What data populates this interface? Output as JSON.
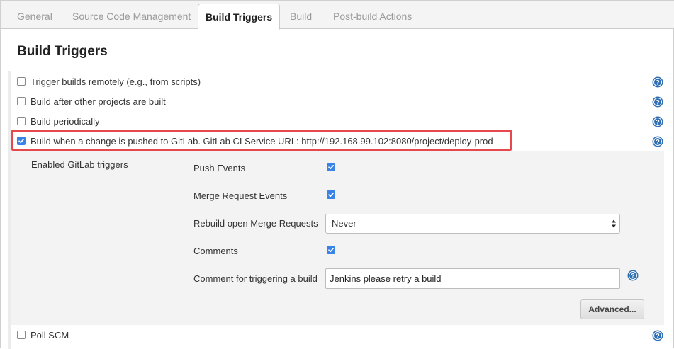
{
  "tabs": [
    {
      "label": "General"
    },
    {
      "label": "Source Code Management"
    },
    {
      "label": "Build Triggers"
    },
    {
      "label": "Build"
    },
    {
      "label": "Post-build Actions"
    }
  ],
  "section": {
    "title": "Build Triggers"
  },
  "triggers": [
    {
      "label": "Trigger builds remotely (e.g., from scripts)",
      "checked": false
    },
    {
      "label": "Build after other projects are built",
      "checked": false
    },
    {
      "label": "Build periodically",
      "checked": false
    },
    {
      "label": "Build when a change is pushed to GitLab. GitLab CI Service URL: http://192.168.99.102:8080/project/deploy-prod",
      "checked": true
    }
  ],
  "gitlab": {
    "enabled_label": "Enabled GitLab triggers",
    "push_events": {
      "label": "Push Events",
      "checked": true
    },
    "merge_request_events": {
      "label": "Merge Request Events",
      "checked": true
    },
    "rebuild_open_mr": {
      "label": "Rebuild open Merge Requests",
      "value": "Never"
    },
    "comments": {
      "label": "Comments",
      "checked": true
    },
    "comment_trigger": {
      "label": "Comment for triggering a build",
      "value": "Jenkins please retry a build"
    },
    "advanced_label": "Advanced..."
  },
  "poll_scm": {
    "label": "Poll SCM",
    "checked": false
  },
  "colors": {
    "accent": "#3a83e6",
    "highlight": "#e5484d",
    "help": "#2f6fb3"
  }
}
